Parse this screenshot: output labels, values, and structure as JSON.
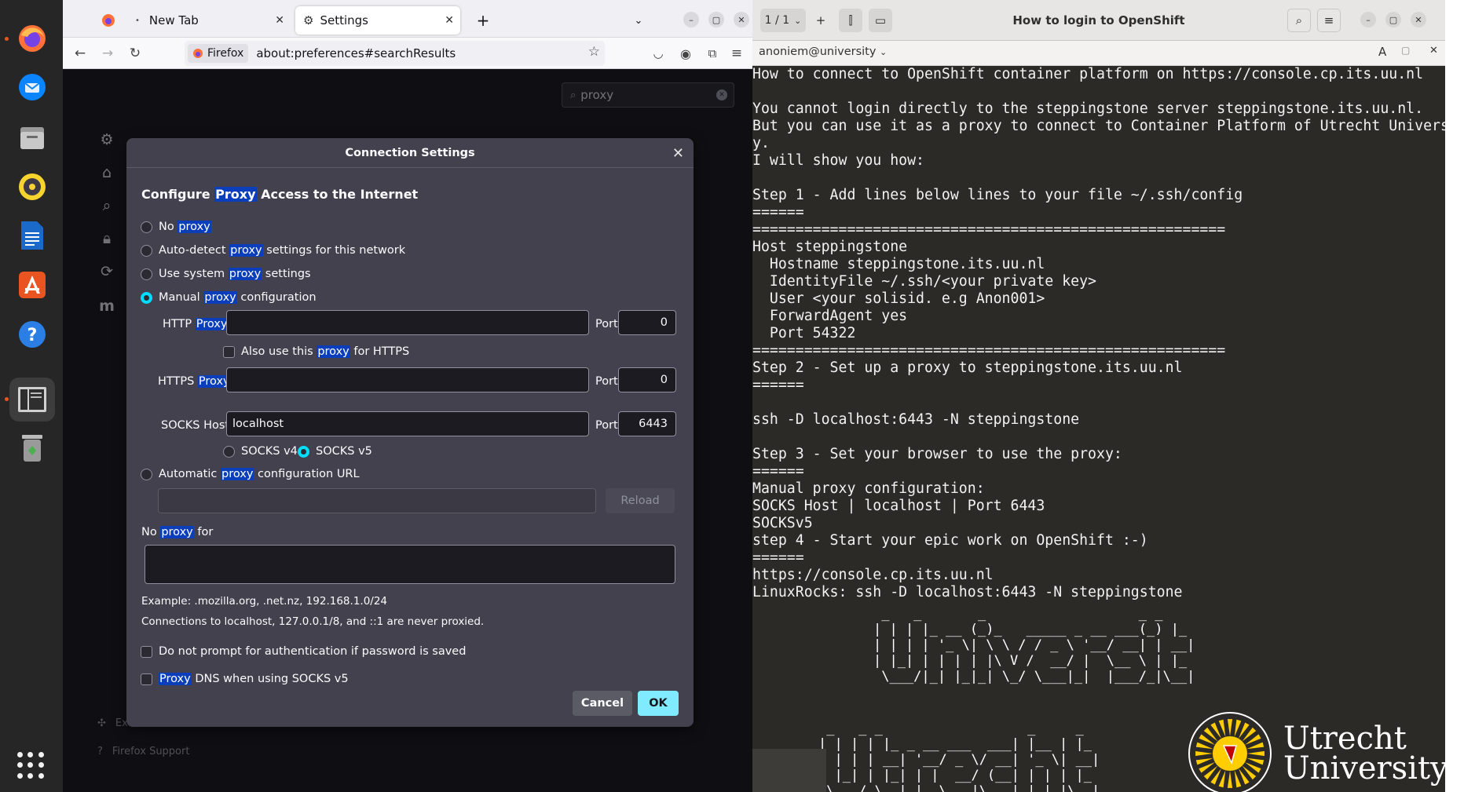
{
  "dock": {
    "apps": [
      {
        "name": "firefox",
        "color": "#ff7139"
      },
      {
        "name": "thunderbird",
        "color": "#0a84ff"
      },
      {
        "name": "files",
        "color": "#8a8a8a"
      },
      {
        "name": "rhythmbox",
        "color": "#f6d32d"
      },
      {
        "name": "libreoffice-writer",
        "color": "#1b6ac9"
      },
      {
        "name": "app-center",
        "color": "#e95420"
      },
      {
        "name": "help",
        "color": "#2a7ee4"
      },
      {
        "name": "document-viewer",
        "color": "#7a7a7a"
      },
      {
        "name": "trash",
        "color": "#8a8a8a"
      }
    ]
  },
  "firefox": {
    "tabs": [
      {
        "label": "New Tab"
      },
      {
        "label": "Settings"
      }
    ],
    "new_tab_symbol": "+",
    "identity_label": "Firefox",
    "url": "about:preferences#searchResults",
    "prefs_search_value": "proxy",
    "footer": {
      "extensions": "Extensions & Themes",
      "support": "Firefox Support"
    }
  },
  "dialog": {
    "title": "Connection Settings",
    "heading_pre": "Configure ",
    "heading_hl": "Proxy",
    "heading_post": " Access to the Internet",
    "options": {
      "no_proxy_pre": "No ",
      "no_proxy_hl": "proxy",
      "auto_pre": "Auto-detect ",
      "auto_hl": "proxy",
      "auto_post": " settings for this network",
      "system_pre": "Use system ",
      "system_hl": "proxy",
      "system_post": " settings",
      "manual_pre": "Manual ",
      "manual_hl": "proxy",
      "manual_post": " configuration",
      "pac_pre": "Automatic ",
      "pac_hl": "proxy",
      "pac_post": " configuration URL"
    },
    "http_label_pre": "HTTP ",
    "http_label_hl": "Proxy",
    "http_value": "",
    "http_port": "0",
    "also_https_pre": "Also use this ",
    "also_https_hl": "proxy",
    "also_https_post": " for HTTPS",
    "https_label_pre": "HTTPS ",
    "https_label_hl": "Proxy",
    "https_value": "",
    "https_port": "0",
    "socks_label": "SOCKS Host",
    "socks_value": "localhost",
    "socks_port": "6443",
    "port_label": "Port",
    "socks_v4": "SOCKS v4",
    "socks_v5": "SOCKS v5",
    "reload_label": "Reload",
    "pac_value": "",
    "no_proxy_for_pre": "No ",
    "no_proxy_for_hl": "proxy",
    "no_proxy_for_post": " for",
    "no_proxy_for_value": "",
    "example_text": "Example: .mozilla.org, .net.nz, 192.168.1.0/24",
    "localhost_note": "Connections to localhost, 127.0.0.1/8, and ::1 are never proxied.",
    "no_prompt_label": "Do not prompt for authentication if password is saved",
    "proxy_dns_hl": "Proxy",
    "proxy_dns_post": " DNS when using SOCKS v5",
    "cancel_label": "Cancel",
    "ok_label": "OK",
    "selected_option": "manual",
    "selected_socks": "v5",
    "accent_color": "#00ddff"
  },
  "reader": {
    "page_indicator": "1 / 1",
    "title": "How to login to OpenShift",
    "account": "anoniem@university",
    "lines": [
      "How to connect to OpenShift container platform on https://console.cp.its.uu.nl",
      "",
      "You cannot login directly to the steppingstone server steppingstone.its.uu.nl.",
      "But you can use it as a proxy to connect to Container Platform of Utrecht Universit",
      "y.",
      "I will show you how:",
      "",
      "Step 1 - Add lines below lines to your file ~/.ssh/config",
      "======",
      "=======================================================",
      "Host steppingstone",
      "  Hostname steppingstone.its.uu.nl",
      "  IdentityFile ~/.ssh/<your private key>",
      "  User <your solisid. e.g Anon001>",
      "  ForwardAgent yes",
      "  Port 54322",
      "=======================================================",
      "Step 2 - Set up a proxy to steppingstone.its.uu.nl",
      "======",
      "",
      "ssh -D localhost:6443 -N steppingstone",
      "",
      "Step 3 - Set your browser to use the proxy:",
      "======",
      "Manual proxy configuration:",
      "SOCKS Host | localhost | Port 6443",
      "SOCKSv5",
      "step 4 - Start your epic work on OpenShift :-)",
      "======",
      "https://console.cp.its.uu.nl",
      "LinuxRocks: ssh -D localhost:6443 -N steppingstone"
    ],
    "ascii_art": [
      " _   _       _                   _ _ ",
      "| | | |_ __ (_)_   _____ _ __ ___(_) |_ ",
      "| | | | '_ \\| \\ \\ / / _ \\ '__/ __| | __|",
      "| |_| | | | | |\\ V /  __/ |  \\__ \\ | |_ ",
      " \\___/|_| |_|_| \\_/ \\___|_|  |___/_|\\__|"
    ],
    "ascii_art_2": [
      " _   _ _                  _     _   ",
      "| | | | |_ _ __ ___  ___| |__ | |_ ",
      "| | | | __| '__/ _ \\/ __| '_ \\| __|",
      "| |_| | |_| | |  __/ (__| | | | |_ ",
      " \\___/ \\__|_|  \\___|\\___|_| |_|\\__|"
    ],
    "logo_line1": "Utrecht",
    "logo_line2": "University",
    "logo_color": "#ffcd00"
  }
}
